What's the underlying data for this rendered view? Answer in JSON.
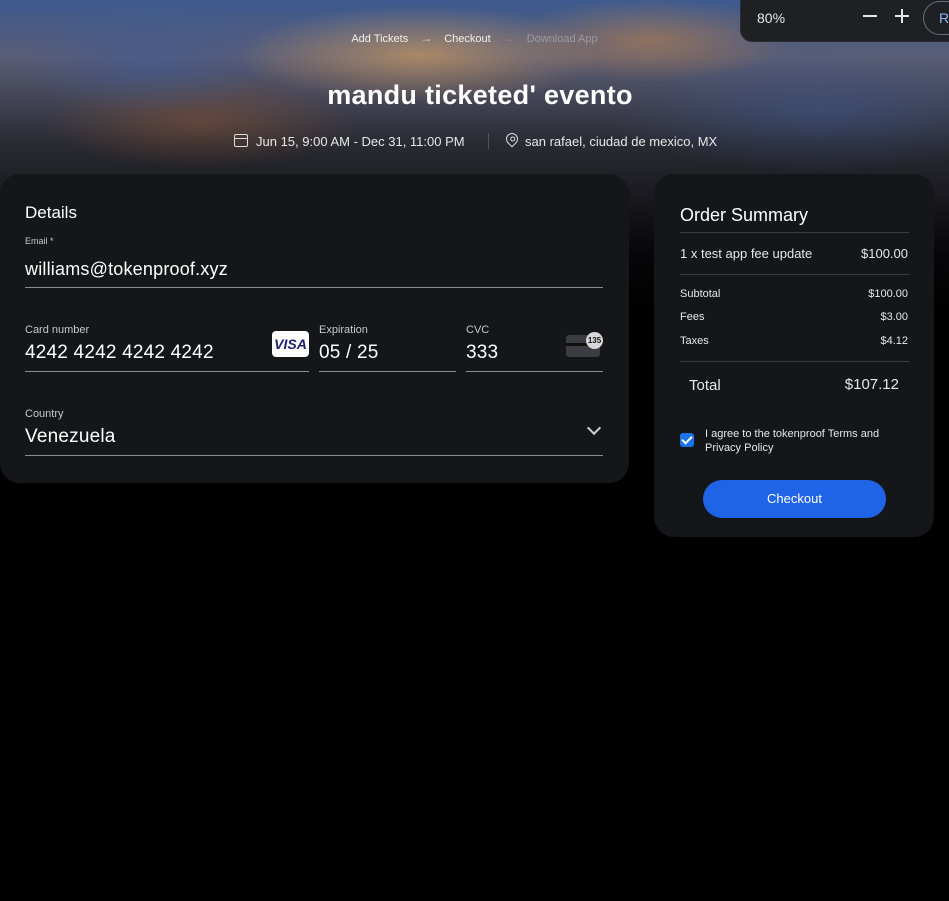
{
  "zoom": {
    "value": "80%",
    "reset_label": "Reset"
  },
  "breadcrumb": {
    "step1": "Add Tickets",
    "step2": "Checkout",
    "step3": "Download App",
    "arrow": "→"
  },
  "event": {
    "title": "mandu ticketed' evento",
    "date": "Jun 15, 9:00 AM - Dec 31, 11:00 PM",
    "location": "san rafael, ciudad de mexico, MX"
  },
  "details": {
    "title": "Details",
    "email_label": "Email *",
    "email_value": "williams@tokenproof.xyz",
    "card_label": "Card number",
    "card_value": "4242 4242 4242 4242",
    "card_brand": "VISA",
    "exp_label": "Expiration",
    "exp_value": "05 / 25",
    "cvc_label": "CVC",
    "cvc_value": "333",
    "cvc_hint": "135",
    "country_label": "Country",
    "country_value": "Venezuela"
  },
  "summary": {
    "title": "Order Summary",
    "item_label": "1 x test app fee update",
    "item_value": "$100.00",
    "subtotal_label": "Subtotal",
    "subtotal_value": "$100.00",
    "fees_label": "Fees",
    "fees_value": "$3.00",
    "taxes_label": "Taxes",
    "taxes_value": "$4.12",
    "total_label": "Total",
    "total_value": "$107.12",
    "agree_text": "I agree to the tokenproof Terms and Privacy Policy",
    "agree_checked": true,
    "checkout_label": "Checkout"
  },
  "colors": {
    "accent": "#1f63e6",
    "card_bg": "#15161a",
    "page_bg": "#000000"
  }
}
